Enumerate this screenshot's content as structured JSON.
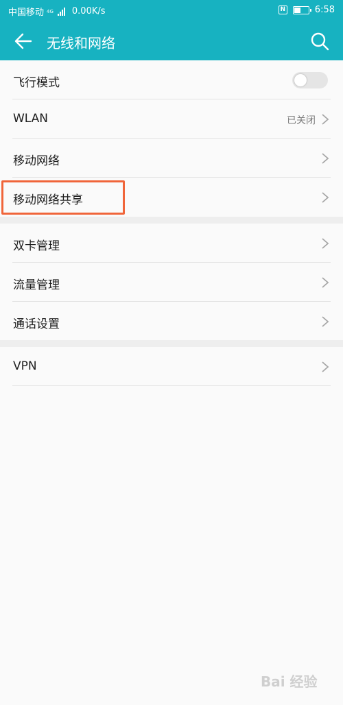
{
  "status_bar": {
    "carrier": "中国移动",
    "network_type": "4G",
    "speed": "0.00K/s",
    "time": "6:58"
  },
  "app_bar": {
    "title": "无线和网络"
  },
  "settings": {
    "airplane_mode": {
      "label": "飞行模式",
      "enabled": false
    },
    "wlan": {
      "label": "WLAN",
      "value": "已关闭"
    },
    "mobile_network": {
      "label": "移动网络"
    },
    "tethering": {
      "label": "移动网络共享"
    },
    "dual_sim": {
      "label": "双卡管理"
    },
    "data_usage": {
      "label": "流量管理"
    },
    "call_settings": {
      "label": "通话设置"
    },
    "vpn": {
      "label": "VPN"
    }
  },
  "annotation": {
    "highlight_color": "#f0653a"
  },
  "watermark": {
    "text": "Bai 经验"
  },
  "colors": {
    "accent": "#17b2c1",
    "background": "#fafafa"
  }
}
